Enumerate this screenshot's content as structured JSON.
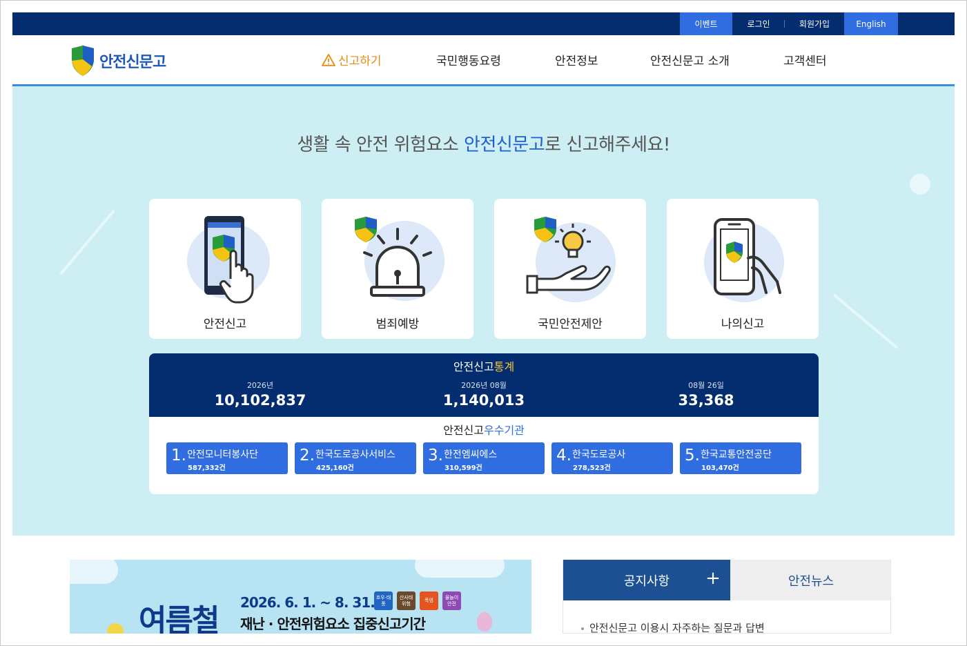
{
  "topbar": {
    "event": "이벤트",
    "login": "로그인",
    "join": "회원가입",
    "english": "English"
  },
  "header": {
    "logo_text": "안전신문고",
    "nav": {
      "report": "신고하기",
      "action": "국민행동요령",
      "info": "안전정보",
      "about": "안전신문고 소개",
      "cs": "고객센터"
    }
  },
  "hero": {
    "title_pre": "생활 속 안전 위험요소 ",
    "title_hl": "안전신문고",
    "title_post": "로 신고해주세요!",
    "cards": [
      {
        "label": "안전신고"
      },
      {
        "label": "범죄예방"
      },
      {
        "label": "국민안전제안"
      },
      {
        "label": "나의신고"
      }
    ]
  },
  "stats": {
    "title_pre": "안전신고",
    "title_accent": "통계",
    "items": [
      {
        "label": "2026년",
        "value": "10,102,837"
      },
      {
        "label": "2026년 08월",
        "value": "1,140,013"
      },
      {
        "label": "08월 26일",
        "value": "33,368"
      }
    ],
    "best_pre": "안전신고",
    "best_accent": "우수기관",
    "orgs": [
      {
        "rank": "1.",
        "name": "안전모니터봉사단",
        "count": "587,332건"
      },
      {
        "rank": "2.",
        "name": "한국도로공사서비스",
        "count": "425,160건"
      },
      {
        "rank": "3.",
        "name": "한전엠씨에스",
        "count": "310,599건"
      },
      {
        "rank": "4.",
        "name": "한국도로공사",
        "count": "278,523건"
      },
      {
        "rank": "5.",
        "name": "한국교통안전공단",
        "count": "103,470건"
      }
    ]
  },
  "banner": {
    "season": "여름철",
    "date": "2026. 6. 1. ~ 8. 31.",
    "subtitle": "재난 · 안전위험요소 집중신고기간",
    "badges": [
      "호우·태풍",
      "산사태 위험",
      "폭염",
      "물놀이 안전"
    ]
  },
  "notice": {
    "tab_active": "공지사항",
    "tab_other": "안전뉴스",
    "plus": "+",
    "items": [
      "안전신문고 이용시 자주하는 질문과 답변"
    ]
  },
  "colors": {
    "navy": "#042d6f",
    "accent_blue": "#2f6de0",
    "hero_bg": "#cdeff3",
    "report_orange": "#e98a14"
  }
}
